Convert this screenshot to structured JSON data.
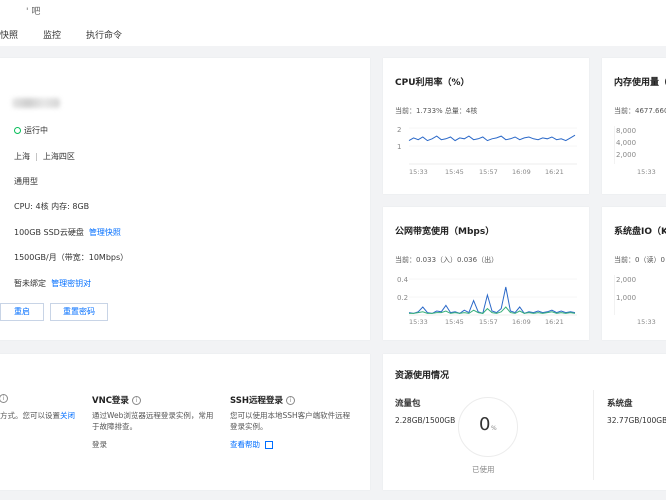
{
  "header": {
    "title_fragment": "' 吧"
  },
  "tabs": [
    "快照",
    "监控",
    "执行命令"
  ],
  "instance": {
    "status": "运行中",
    "region": "上海",
    "separator": "|",
    "zone": "上海四区",
    "type": "通用型",
    "cpu_mem": "CPU: 4核 内存: 8GB",
    "disk": "100GB SSD云硬盘",
    "disk_link": "管理快照",
    "traffic": "1500GB/月（带宽：10Mbps）",
    "bind": "暂未绑定",
    "bind_link": "管理密钥对",
    "restart_btn": "重启",
    "reset_pwd_btn": "重置密码"
  },
  "cpu": {
    "title": "CPU利用率（%）",
    "current": "当前：1.733% 总量：4核",
    "y_ticks": [
      "2",
      "1"
    ],
    "x_ticks": [
      "15:33",
      "15:45",
      "15:57",
      "16:09",
      "16:21"
    ]
  },
  "memory": {
    "title": "内存使用量（",
    "current": "当前：4677.660",
    "y_ticks": [
      "8,000",
      "4,000",
      "2,000"
    ],
    "x_ticks": [
      "15:33"
    ]
  },
  "bandwidth": {
    "title": "公网带宽使用（Mbps）",
    "current": "当前：0.033（入）0.036（出）",
    "y_ticks": [
      "0.4",
      "0.2"
    ],
    "x_ticks": [
      "15:33",
      "15:45",
      "15:57",
      "16:09",
      "16:21"
    ]
  },
  "diskio": {
    "title": "系统盘IO（K",
    "current": "当前：0（读）0",
    "y_ticks": [
      "2,000",
      "1,000"
    ],
    "x_ticks": [
      "15:33"
    ]
  },
  "login": {
    "left_desc_a": "方式。您可以设置",
    "left_desc_link": "关闭",
    "vnc_title": "VNC登录",
    "vnc_desc": "通过Web浏览器远程登录实例，常用于故障排查。",
    "vnc_link": "登录",
    "ssh_title": "SSH远程登录",
    "ssh_desc": "您可以使用本地SSH客户端软件远程登录实例。",
    "ssh_link": "查看帮助"
  },
  "resources": {
    "title": "资源使用情况",
    "traffic_label": "流量包",
    "traffic_value": "2.28GB/1500GB",
    "ring_value": "0",
    "ring_unit": "%",
    "used_label": "已使用",
    "sysdisk_label": "系统盘",
    "sysdisk_value": "32.77GB/100GB"
  },
  "chart_data": [
    {
      "type": "line",
      "title": "CPU利用率（%）",
      "x": [
        "15:33",
        "15:45",
        "15:57",
        "16:09",
        "16:21"
      ],
      "ylim": [
        0.5,
        2.5
      ],
      "series": [
        {
          "values": [
            1.8,
            1.95,
            1.85,
            2.0,
            1.8,
            1.9,
            2.05,
            1.85,
            1.9,
            2.0,
            1.8,
            1.95,
            1.9,
            2.05,
            1.85,
            1.9,
            2.0,
            1.8,
            1.9,
            1.95,
            2.05,
            1.85,
            1.9,
            2.0,
            1.85,
            1.95,
            2.0,
            1.9,
            1.85,
            1.95,
            1.9,
            2.0,
            1.85,
            1.9,
            1.8,
            1.95,
            2.1
          ],
          "color": "#2a68c8"
        }
      ]
    },
    {
      "type": "line",
      "title": "公网带宽使用（Mbps）",
      "x": [
        "15:33",
        "15:45",
        "15:57",
        "16:09",
        "16:21"
      ],
      "ylim": [
        0,
        0.5
      ],
      "series": [
        {
          "values": [
            0.03,
            0.02,
            0.04,
            0.1,
            0.03,
            0.02,
            0.05,
            0.04,
            0.12,
            0.03,
            0.04,
            0.02,
            0.06,
            0.03,
            0.18,
            0.04,
            0.02,
            0.25,
            0.05,
            0.03,
            0.08,
            0.35,
            0.05,
            0.03,
            0.1,
            0.02,
            0.04,
            0.03,
            0.05,
            0.03,
            0.04,
            0.06,
            0.03,
            0.05,
            0.03,
            0.04,
            0.03
          ],
          "color": "#2a68c8"
        },
        {
          "values": [
            0.02,
            0.02,
            0.03,
            0.04,
            0.02,
            0.02,
            0.03,
            0.03,
            0.05,
            0.02,
            0.03,
            0.02,
            0.03,
            0.02,
            0.06,
            0.03,
            0.02,
            0.08,
            0.03,
            0.02,
            0.04,
            0.1,
            0.03,
            0.02,
            0.05,
            0.02,
            0.03,
            0.02,
            0.03,
            0.02,
            0.03,
            0.04,
            0.02,
            0.03,
            0.02,
            0.03,
            0.02
          ],
          "color": "#38b07a"
        }
      ]
    }
  ]
}
